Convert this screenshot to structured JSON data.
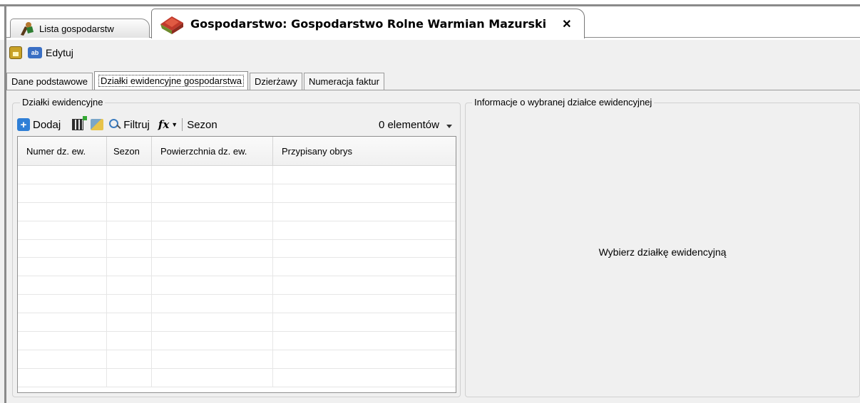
{
  "doc_tabs": {
    "list_label": "Lista gospodarstw",
    "farm_label": "Gospodarstwo: Gospodarstwo Rolne Warmian Mazurski",
    "close_glyph": "✕"
  },
  "toolbar": {
    "edit_label": "Edytuj",
    "lock_icon": "lock-icon",
    "edit_icon": "edit-icon",
    "edit_icon_text": "ab"
  },
  "inner_tabs": [
    {
      "label": "Dane podstawowe",
      "active": false
    },
    {
      "label": "Działki ewidencyjne gospodarstwa",
      "active": true
    },
    {
      "label": "Dzierżawy",
      "active": false
    },
    {
      "label": "Numeracja faktur",
      "active": false
    }
  ],
  "left_group": {
    "title": "Działki ewidencyjne",
    "add_label": "Dodaj",
    "filter_label": "Filtruj",
    "fx_label": "fx",
    "season_label": "Sezon",
    "count_label": "0 elementów",
    "columns": [
      "Numer dz. ew.",
      "Sezon",
      "Powierzchnia dz. ew.",
      "Przypisany obrys"
    ],
    "rows": []
  },
  "right_group": {
    "title": "Informacje o wybranej działce ewidencyjnej",
    "placeholder": "Wybierz działkę ewidencyjną"
  },
  "colors": {
    "accent": "#2f7fd6",
    "tab_border": "#8a8a8a"
  }
}
